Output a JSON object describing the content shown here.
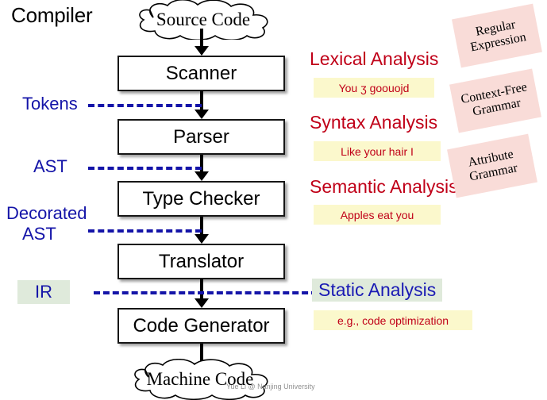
{
  "title": "Compiler",
  "watermark": "Yue Li @ Nanjing University",
  "clouds": {
    "input": "Source Code",
    "output": "Machine Code"
  },
  "stages": [
    {
      "label": "Scanner"
    },
    {
      "label": "Parser"
    },
    {
      "label": "Type Checker"
    },
    {
      "label": "Translator"
    },
    {
      "label": "Code Generator"
    }
  ],
  "left_labels": [
    {
      "label": "Tokens"
    },
    {
      "label": "AST"
    },
    {
      "label": "Decorated"
    },
    {
      "label": "AST"
    },
    {
      "label": "IR"
    }
  ],
  "analyses": [
    {
      "label": "Lexical Analysis"
    },
    {
      "label": "Syntax Analysis"
    },
    {
      "label": "Semantic Analysis"
    },
    {
      "label": "Static Analysis"
    }
  ],
  "notes": [
    {
      "text": "You ʒ goouojd"
    },
    {
      "text": "Like your hair I"
    },
    {
      "text": "Apples eat you"
    },
    {
      "text": "e.g., code optimization"
    }
  ],
  "tags": [
    {
      "line1": "Regular",
      "line2": "Expression"
    },
    {
      "line1": "Context-Free",
      "line2": "Grammar"
    },
    {
      "line1": "Attribute",
      "line2": "Grammar"
    }
  ],
  "colors": {
    "red": "#c00018",
    "blue": "#1414a8",
    "green_bg": "#dfeadb",
    "yellow_bg": "#fbf8cc",
    "pink_bg": "#f9dcd8",
    "box_border": "#161616"
  }
}
